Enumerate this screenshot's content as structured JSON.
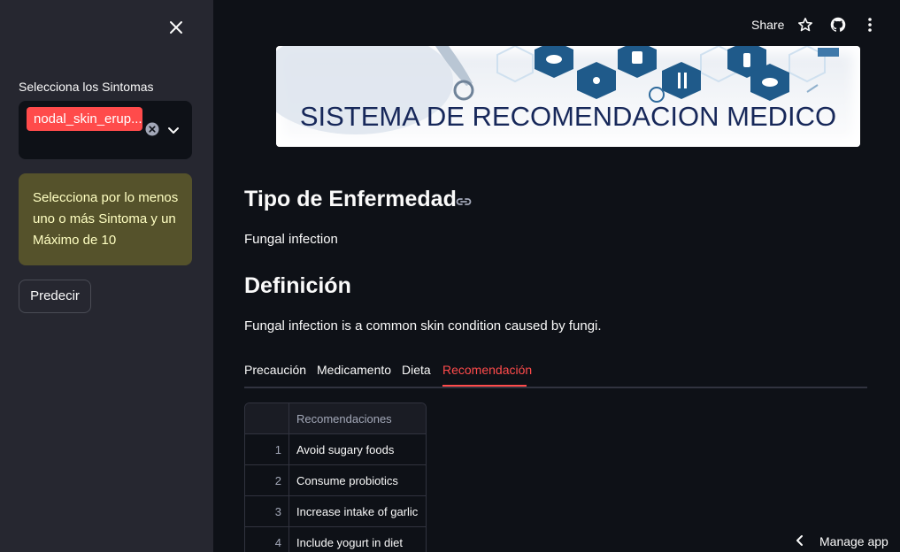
{
  "sidebar": {
    "symptoms_label": "Selecciona los Sintomas",
    "selected_symptom": "nodal_skin_erup...",
    "warning_text": "Selecciona por lo menos uno o más Sintoma y un Máximo de 10",
    "predict_button": "Predecir"
  },
  "header": {
    "share_label": "Share",
    "icons": [
      "star-icon",
      "github-icon",
      "more-vertical-icon"
    ]
  },
  "banner": {
    "title": "SISTEMA DE RECOMENDACION MEDICO"
  },
  "main": {
    "disease_heading": "Tipo de Enfermedad",
    "disease_value": "Fungal infection",
    "definition_heading": "Definición",
    "definition_text": "Fungal infection is a common skin condition caused by fungi.",
    "tabs": [
      {
        "label": "Precaución",
        "active": false
      },
      {
        "label": "Medicamento",
        "active": false
      },
      {
        "label": "Dieta",
        "active": false
      },
      {
        "label": "Recomendación",
        "active": true
      }
    ],
    "table": {
      "column_header": "Recomendaciones",
      "rows": [
        {
          "index": "1",
          "value": "Avoid sugary foods"
        },
        {
          "index": "2",
          "value": "Consume probiotics"
        },
        {
          "index": "3",
          "value": "Increase intake of garlic"
        },
        {
          "index": "4",
          "value": "Include yogurt in diet"
        }
      ]
    }
  },
  "footer": {
    "manage_app": "Manage app"
  },
  "colors": {
    "accent": "#ff4b4b",
    "sidebar_bg": "#262730",
    "app_bg": "#0e1117",
    "warning_bg": "#55522b",
    "warning_text": "#ffffc2"
  }
}
